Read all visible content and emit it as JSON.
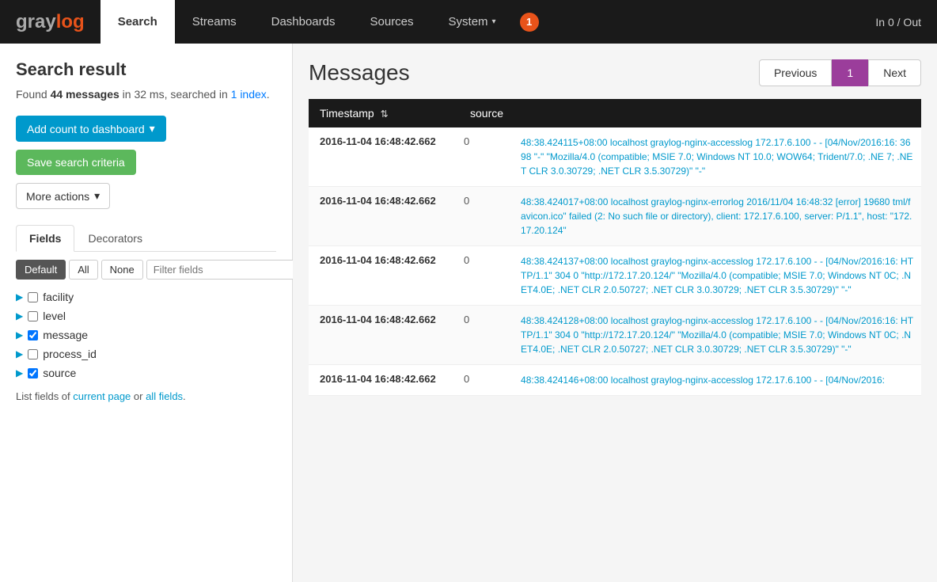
{
  "brand": {
    "gray": "gray",
    "log": "log"
  },
  "nav": {
    "items": [
      {
        "label": "Search",
        "active": true
      },
      {
        "label": "Streams",
        "active": false
      },
      {
        "label": "Dashboards",
        "active": false
      },
      {
        "label": "Sources",
        "active": false
      },
      {
        "label": "System",
        "active": false,
        "dropdown": true
      }
    ],
    "badge": "1",
    "right_label": "In 0 / Out"
  },
  "sidebar": {
    "title": "Search result",
    "result_count": "44 messages",
    "result_meta": "in 32 ms, searched in",
    "result_index": "1 index",
    "buttons": {
      "add_dashboard": "Add count to dashboard",
      "save_search": "Save search criteria",
      "more_actions": "More actions"
    },
    "tabs": [
      "Fields",
      "Decorators"
    ],
    "active_tab": "Fields",
    "field_filters": [
      "Default",
      "All",
      "None"
    ],
    "field_filter_placeholder": "Filter fields",
    "fields": [
      {
        "name": "facility",
        "checked": false
      },
      {
        "name": "level",
        "checked": false
      },
      {
        "name": "message",
        "checked": true
      },
      {
        "name": "process_id",
        "checked": false
      },
      {
        "name": "source",
        "checked": true
      }
    ],
    "list_footer_prefix": "List fields of",
    "list_footer_current": "current page",
    "list_footer_or": "or",
    "list_footer_all": "all fields",
    "list_footer_suffix": "."
  },
  "content": {
    "title": "Messages",
    "pagination": {
      "previous": "Previous",
      "current": "1",
      "next": "Next"
    },
    "table_headers": [
      "Timestamp",
      "source"
    ],
    "messages": [
      {
        "timestamp": "2016-11-04 16:48:42.662",
        "source": "0",
        "body": "48:38.424115+08:00 localhost graylog-nginx-accesslog 172.17.6.100 - - [04/Nov/2016:16: 3698 \"-\" \"Mozilla/4.0 (compatible; MSIE 7.0; Windows NT 10.0; WOW64; Trident/7.0; .NE 7; .NET CLR 3.0.30729; .NET CLR 3.5.30729)\" \"-\""
      },
      {
        "timestamp": "2016-11-04 16:48:42.662",
        "source": "0",
        "body": "48:38.424017+08:00 localhost graylog-nginx-errorlog 2016/11/04 16:48:32 [error] 19680 tml/favicon.ico\" failed (2: No such file or directory), client: 172.17.6.100, server: P/1.1\", host: \"172.17.20.124\""
      },
      {
        "timestamp": "2016-11-04 16:48:42.662",
        "source": "0",
        "body": "48:38.424137+08:00 localhost graylog-nginx-accesslog 172.17.6.100 - - [04/Nov/2016:16: HTTP/1.1\" 304 0 \"http://172.17.20.124/\" \"Mozilla/4.0 (compatible; MSIE 7.0; Windows NT 0C; .NET4.0E; .NET CLR 2.0.50727; .NET CLR 3.0.30729; .NET CLR 3.5.30729)\" \"-\""
      },
      {
        "timestamp": "2016-11-04 16:48:42.662",
        "source": "0",
        "body": "48:38.424128+08:00 localhost graylog-nginx-accesslog 172.17.6.100 - - [04/Nov/2016:16: HTTP/1.1\" 304 0 \"http://172.17.20.124/\" \"Mozilla/4.0 (compatible; MSIE 7.0; Windows NT 0C; .NET4.0E; .NET CLR 2.0.50727; .NET CLR 3.0.30729; .NET CLR 3.5.30729)\" \"-\""
      },
      {
        "timestamp": "2016-11-04 16:48:42.662",
        "source": "0",
        "body": "48:38.424146+08:00 localhost graylog-nginx-accesslog 172.17.6.100 - - [04/Nov/2016:"
      }
    ]
  }
}
